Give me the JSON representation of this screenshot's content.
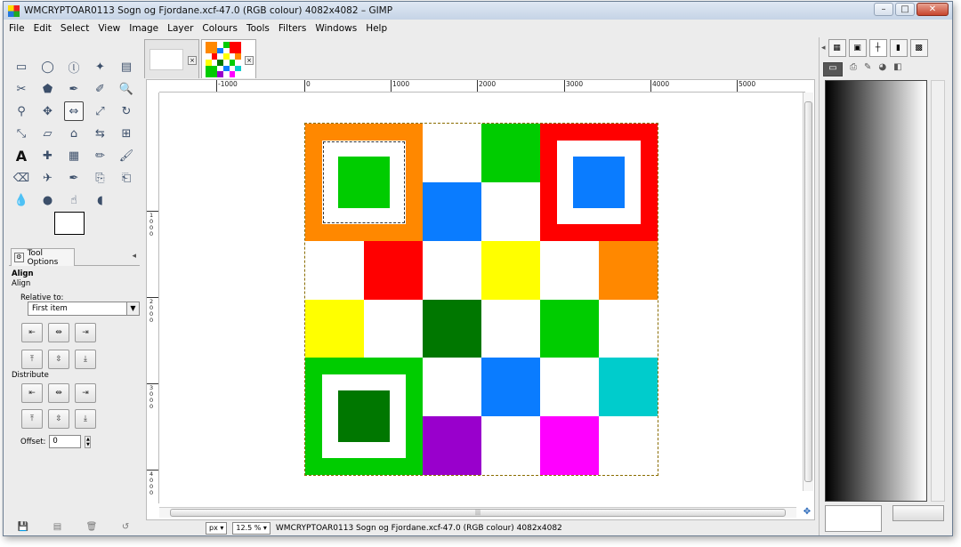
{
  "window": {
    "title": "WMCRYPTOAR0113 Sogn og Fjordane.xcf-47.0 (RGB colour) 4082x4082 – GIMP"
  },
  "menu": [
    "File",
    "Edit",
    "Select",
    "View",
    "Image",
    "Layer",
    "Colours",
    "Tools",
    "Filters",
    "Windows",
    "Help"
  ],
  "toolbox": {
    "tools": [
      "rect-select",
      "ellipse-select",
      "free-select",
      "fuzzy-select",
      "select-by-color",
      "scissors",
      "foreground-select",
      "paths",
      "color-picker",
      "zoom",
      "measure",
      "move",
      "align",
      "transform",
      "rotate",
      "scale",
      "shear",
      "perspective",
      "flip",
      "cage",
      "text",
      "heal",
      "blend",
      "pencil",
      "paintbrush",
      "eraser",
      "airbrush",
      "ink",
      "clone",
      "perspective-clone",
      "blur",
      "dodge",
      "smudge",
      "burn"
    ],
    "tab_label": "Tool Options",
    "options": {
      "heading": "Align",
      "sub": "Align",
      "relative_label": "Relative to:",
      "relative_value": "First item",
      "distribute_label": "Distribute",
      "offset_label": "Offset:",
      "offset_value": "0"
    }
  },
  "ruler": {
    "h": [
      "-1000",
      "0",
      "1000",
      "2000",
      "3000",
      "4000",
      "5000"
    ],
    "v": [
      "1000",
      "2000",
      "3000",
      "4000"
    ]
  },
  "status": {
    "unit": "px",
    "zoom": "12.5 %",
    "text": "WMCRYPTOAR0113 Sogn og Fjordane.xcf-47.0 (RGB colour) 4082x4082"
  },
  "image": {
    "grid": [
      [
        "orange",
        "orange",
        "#ffffff",
        "#00cc00",
        "red",
        "red"
      ],
      [
        "orange",
        "orange",
        "#0a7cff",
        "#ffffff",
        "red",
        "red"
      ],
      [
        "#ffffff",
        "#ff0000",
        "#ffffff",
        "#ffff00",
        "#ffffff",
        "#ff8800"
      ],
      [
        "#ffff00",
        "#ffffff",
        "#007700",
        "#ffffff",
        "#00cc00",
        "#ffffff"
      ],
      [
        "green",
        "green",
        "#ffffff",
        "#0a7cff",
        "#ffffff",
        "#00cccc"
      ],
      [
        "green",
        "green",
        "#9900cc",
        "#ffffff",
        "#ff00ff",
        "#ffffff"
      ]
    ],
    "big_squares": [
      {
        "frame": "#ff8800",
        "core": "#00cc00"
      },
      {
        "frame": "#ff0000",
        "core": "#0a7cff"
      },
      {
        "frame": "#00cc00",
        "core": "#007700"
      }
    ]
  },
  "colors": {
    "accent": "#1d5fb5",
    "selection": "#8a6d00"
  }
}
